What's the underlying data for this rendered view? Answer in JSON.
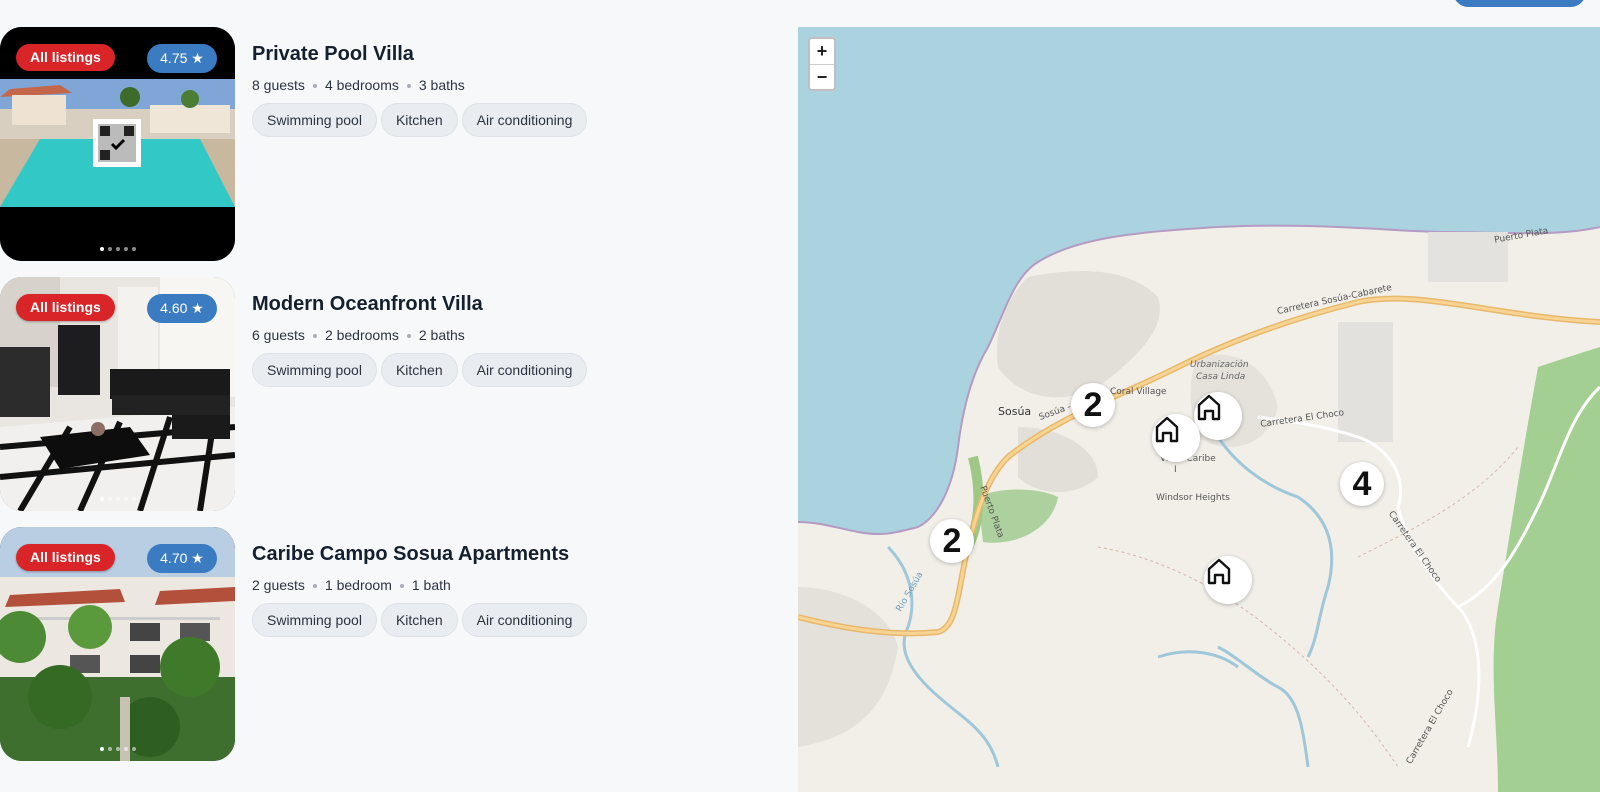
{
  "listings": [
    {
      "badge": "All listings",
      "rating": "4.75 ★",
      "title": "Private Pool Villa",
      "guests": "8 guests",
      "bedrooms": "4 bedrooms",
      "baths": "3 baths",
      "amenities": [
        "Swimming pool",
        "Kitchen",
        "Air conditioning"
      ],
      "photo_dots": 5
    },
    {
      "badge": "All listings",
      "rating": "4.60 ★",
      "title": "Modern Oceanfront Villa",
      "guests": "6 guests",
      "bedrooms": "2 bedrooms",
      "baths": "2 baths",
      "amenities": [
        "Swimming pool",
        "Kitchen",
        "Air conditioning"
      ],
      "photo_dots": 5
    },
    {
      "badge": "All listings",
      "rating": "4.70 ★",
      "title": "Caribe Campo Sosua Apartments",
      "guests": "2 guests",
      "bedrooms": "1 bedroom",
      "baths": "1 bath",
      "amenities": [
        "Swimming pool",
        "Kitchen",
        "Air conditioning"
      ],
      "photo_dots": 5
    }
  ],
  "map": {
    "zoom_in": "+",
    "zoom_out": "−",
    "clusters": [
      "2",
      "2",
      "4"
    ],
    "labels": {
      "town": "Sosúa",
      "coral_village": "Coral Village",
      "urbanizacion": "Urbanización",
      "casa_linda": "Casa Linda",
      "villas_caribe": "Villas Caribe",
      "villas_caribe_2": "I",
      "windsor": "Windsor Heights",
      "carretera_choco": "Carretera El Choco",
      "carretera_choco_2": "Carretera El Choco",
      "carretera_choco_3": "Carretera El Choco",
      "sosua_cabarete": "Carretera Sosúa-Cabarete",
      "sosua_road": "Sosúa - Ca",
      "puerto_plata": "Puerto Plata",
      "puerto_plata_road": "Puerto Plata",
      "rio": "Río Sosúa"
    }
  },
  "colors": {
    "badge_red": "#d92428",
    "rating_blue": "#3a7bc2",
    "water": "#aad3df",
    "land": "#f2efe9",
    "road": "#f4c87f",
    "park": "#9dc97c"
  }
}
